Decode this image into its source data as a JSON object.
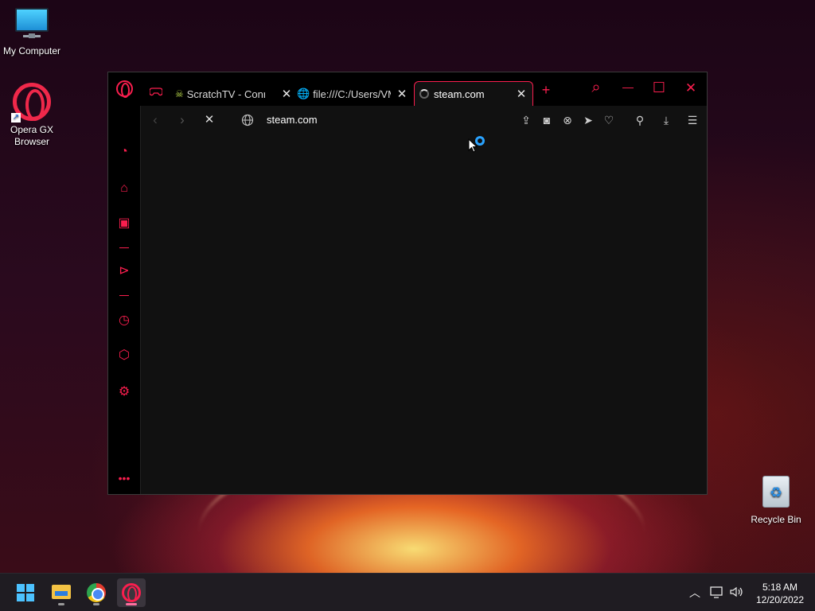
{
  "desktop": {
    "icons": [
      {
        "label": "My Computer"
      },
      {
        "label": "Opera GX Browser"
      },
      {
        "label": "Recycle Bin"
      }
    ]
  },
  "browser": {
    "tabs": [
      {
        "title": "ScratchTV - Conne",
        "close": "✕"
      },
      {
        "title": "file:///C:/Users/VM",
        "close": "✕"
      },
      {
        "title": "steam.com",
        "close": "✕",
        "active": true,
        "loading": true
      }
    ],
    "new_tab": "+",
    "window_controls": {
      "search": "⌕",
      "minimize": "—",
      "maximize": "☐",
      "close": "✕"
    },
    "address": {
      "url": "steam.com"
    },
    "nav": {
      "back": "‹",
      "forward": "›",
      "stop": "✕"
    },
    "accent_color": "#fa1e4e"
  },
  "taskbar": {
    "apps": [
      {
        "name": "start-icon"
      },
      {
        "name": "file-explorer-icon"
      },
      {
        "name": "chrome-icon"
      },
      {
        "name": "opera-gx-icon",
        "active": true
      }
    ],
    "tray": {
      "chevron": "^",
      "time": "5:18 AM",
      "date": "12/20/2022"
    }
  }
}
